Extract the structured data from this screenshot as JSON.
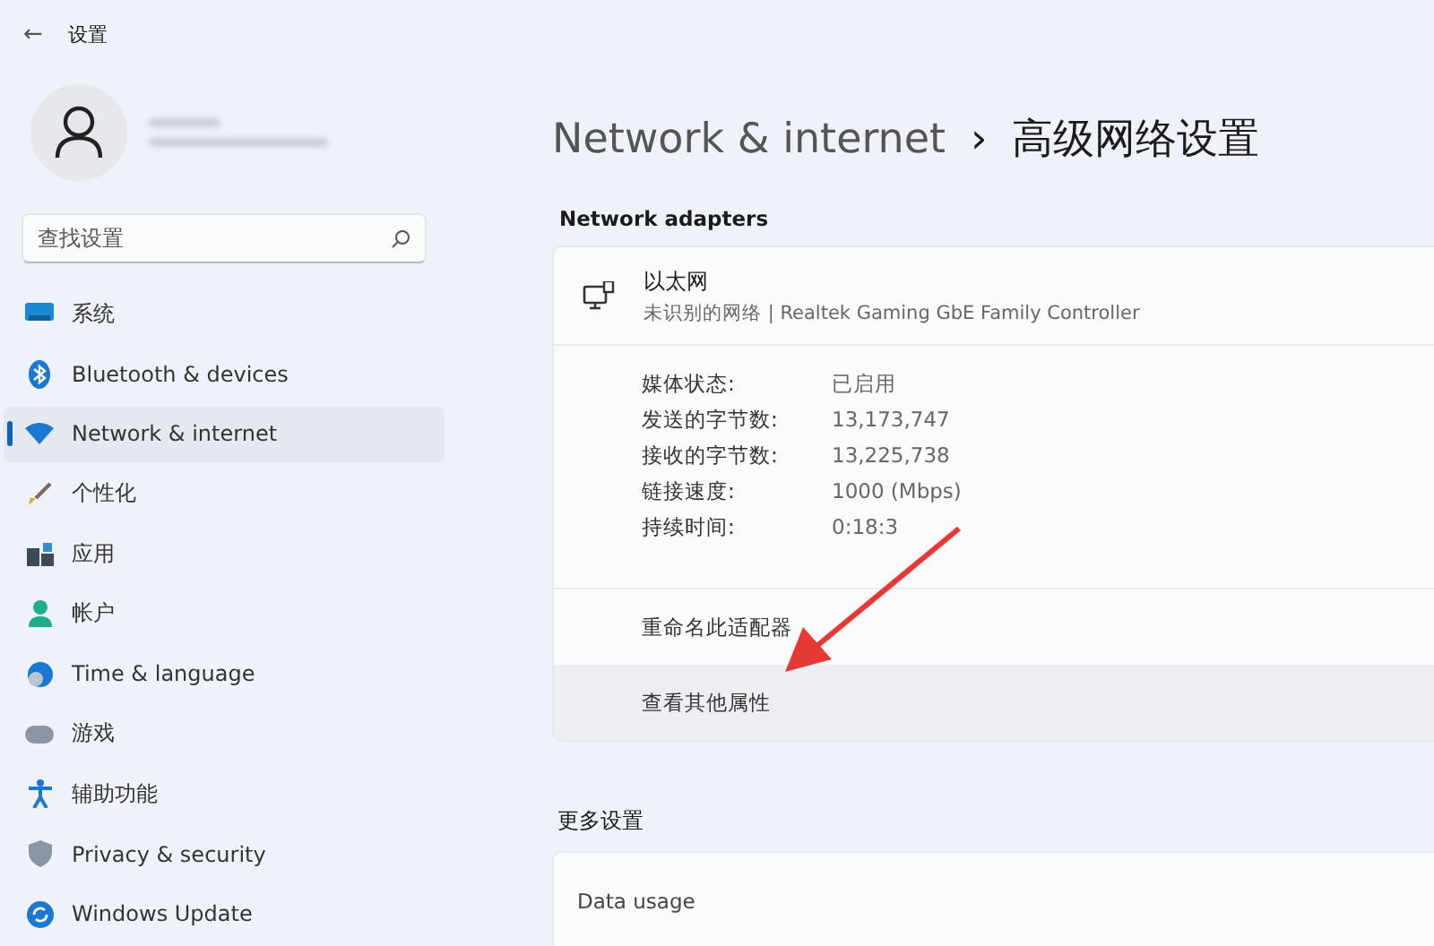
{
  "window": {
    "back": "←",
    "title": "设置"
  },
  "search": {
    "placeholder": "查找设置"
  },
  "sidebar": {
    "items": [
      {
        "label": "系统",
        "selected": false
      },
      {
        "label": "Bluetooth & devices",
        "selected": false
      },
      {
        "label": "Network & internet",
        "selected": true
      },
      {
        "label": "个性化",
        "selected": false
      },
      {
        "label": "应用",
        "selected": false
      },
      {
        "label": "帐户",
        "selected": false
      },
      {
        "label": "Time & language",
        "selected": false
      },
      {
        "label": "游戏",
        "selected": false
      },
      {
        "label": "辅助功能",
        "selected": false
      },
      {
        "label": "Privacy & security",
        "selected": false
      },
      {
        "label": "Windows Update",
        "selected": false
      }
    ]
  },
  "breadcrumb": {
    "parent": "Network & internet",
    "separator": "›",
    "current": "高级网络设置"
  },
  "adapters": {
    "heading": "Network adapters",
    "name": "以太网",
    "description": "未识别的网络 | Realtek Gaming GbE Family Controller",
    "properties": [
      {
        "label": "媒体状态:",
        "value": "已启用"
      },
      {
        "label": "发送的字节数:",
        "value": "13,173,747"
      },
      {
        "label": "接收的字节数:",
        "value": "13,225,738"
      },
      {
        "label": "链接速度:",
        "value": "1000 (Mbps)"
      },
      {
        "label": "持续时间:",
        "value": "0:18:3"
      }
    ],
    "actions": [
      {
        "label": "重命名此适配器",
        "hovered": false
      },
      {
        "label": "查看其他属性",
        "hovered": true
      }
    ]
  },
  "more": {
    "heading": "更多设置",
    "items": [
      "Data usage"
    ]
  }
}
